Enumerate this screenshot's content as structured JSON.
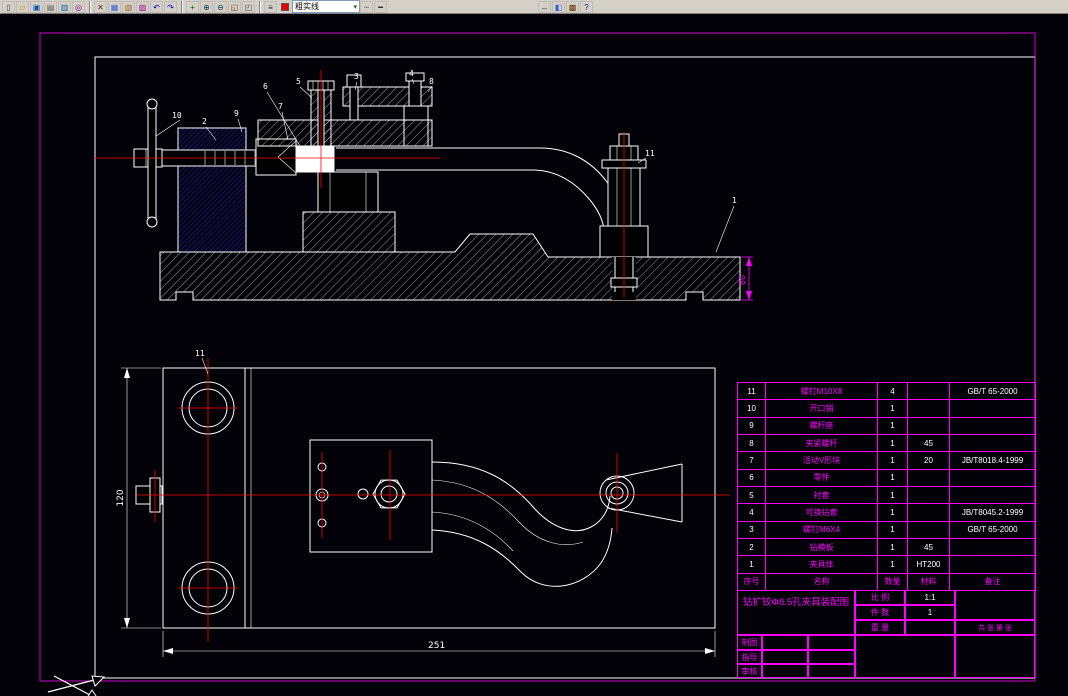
{
  "colors": {
    "frame_magenta": "#ff00ff",
    "centerline_red": "#ff0000",
    "geometry_white": "#ffffff",
    "hatch_blue": "#2222ff",
    "toolbar_gray": "#d4d0c8"
  },
  "toolbar": {
    "layer_value": "粗实线",
    "icons": [
      {
        "name": "new-file-icon",
        "glyph": "▯"
      },
      {
        "name": "open-file-icon",
        "glyph": "▱"
      },
      {
        "name": "save-icon",
        "glyph": "▣"
      },
      {
        "name": "print-icon",
        "glyph": "▤"
      },
      {
        "name": "print-preview-icon",
        "glyph": "▥"
      },
      {
        "name": "find-icon",
        "glyph": "◎"
      },
      {
        "name": "cut-icon",
        "glyph": "✕"
      },
      {
        "name": "copy-icon",
        "glyph": "▦"
      },
      {
        "name": "paste-icon",
        "glyph": "▧"
      },
      {
        "name": "match-properties-icon",
        "glyph": "▨"
      },
      {
        "name": "undo-icon",
        "glyph": "↶"
      },
      {
        "name": "redo-icon",
        "glyph": "↷"
      },
      {
        "name": "pan-icon",
        "glyph": "+"
      },
      {
        "name": "zoom-in-icon",
        "glyph": "⊕"
      },
      {
        "name": "zoom-out-icon",
        "glyph": "⊖"
      },
      {
        "name": "zoom-window-icon",
        "glyph": "◱"
      },
      {
        "name": "zoom-previous-icon",
        "glyph": "◰"
      },
      {
        "name": "layers-icon",
        "glyph": "≡"
      },
      {
        "name": "linetype-icon",
        "glyph": "┅"
      },
      {
        "name": "lineweight-icon",
        "glyph": "━"
      },
      {
        "name": "distance-icon",
        "glyph": "↔"
      },
      {
        "name": "properties-icon",
        "glyph": "◧"
      },
      {
        "name": "calculator-icon",
        "glyph": "▩"
      },
      {
        "name": "help-icon",
        "glyph": "?"
      }
    ]
  },
  "callouts": [
    "1",
    "2",
    "3",
    "4",
    "5",
    "6",
    "7",
    "8",
    "9",
    "10",
    "11"
  ],
  "dimensions": {
    "plan_width": "251",
    "plan_height": "120",
    "base_height": "80"
  },
  "bom": {
    "headers": [
      "序号",
      "名称",
      "数量",
      "材料",
      "备注"
    ],
    "rows": [
      {
        "no": "11",
        "name": "螺钉M10X8",
        "qty": "4",
        "material": "",
        "remark": "GB/T 65-2000"
      },
      {
        "no": "10",
        "name": "开口销",
        "qty": "1",
        "material": "",
        "remark": ""
      },
      {
        "no": "9",
        "name": "螺杆座",
        "qty": "1",
        "material": "",
        "remark": ""
      },
      {
        "no": "8",
        "name": "夹紧螺杆",
        "qty": "1",
        "material": "45",
        "remark": ""
      },
      {
        "no": "7",
        "name": "活动V形块",
        "qty": "1",
        "material": "20",
        "remark": "JB/T8018.4-1999"
      },
      {
        "no": "6",
        "name": "零件",
        "qty": "1",
        "material": "",
        "remark": ""
      },
      {
        "no": "5",
        "name": "衬套",
        "qty": "1",
        "material": "",
        "remark": ""
      },
      {
        "no": "4",
        "name": "可换钻套",
        "qty": "1",
        "material": "",
        "remark": "JB/T8045.2-1999"
      },
      {
        "no": "3",
        "name": "螺钉M6X4",
        "qty": "1",
        "material": "",
        "remark": "GB/T 65-2000"
      },
      {
        "no": "2",
        "name": "钻模板",
        "qty": "1",
        "material": "45",
        "remark": ""
      },
      {
        "no": "1",
        "name": "夹具体",
        "qty": "1",
        "material": "HT200",
        "remark": ""
      }
    ]
  },
  "title_block": {
    "title": "钻扩铰Φ8.5孔夹具装配图",
    "scale_label": "比 例",
    "scale_value": "1:1",
    "qty_label": "件 数",
    "qty_value": "1",
    "weight_label": "重 量",
    "weight_value": "",
    "sheets_label": "共 张 第 张",
    "drawn_label": "制图",
    "guide_label": "指导",
    "check_label": "审核"
  }
}
